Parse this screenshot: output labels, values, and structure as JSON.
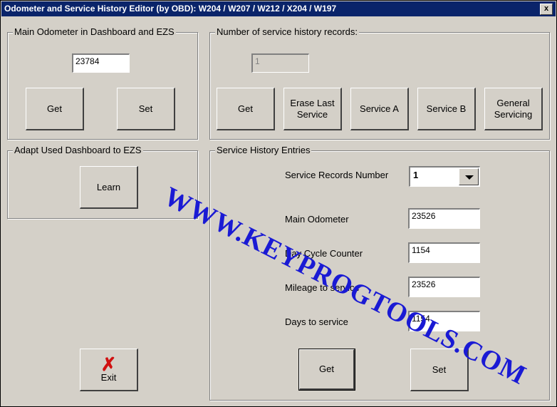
{
  "window": {
    "title": "Odometer and Service History Editor (by OBD): W204 / W207 / W212 / X204 / W197",
    "close_label": "x"
  },
  "odometer_group": {
    "label": "Main Odometer in Dashboard and EZS",
    "value": "23784",
    "get_label": "Get",
    "set_label": "Set"
  },
  "adapt_group": {
    "label": "Adapt Used Dashboard to EZS",
    "learn_label": "Learn"
  },
  "records_group": {
    "label": "Number of service history records:",
    "count": "1",
    "buttons": [
      "Get",
      "Erase Last Service",
      "Service A",
      "Service B",
      "General Servicing"
    ]
  },
  "entries_group": {
    "label": "Service History Entries",
    "records_number_label": "Service Records Number",
    "records_number_value": "1",
    "main_odometer_label": "Main Odometer",
    "main_odometer_value": "23526",
    "day_cycle_label": "Day Cycle Counter",
    "day_cycle_value": "1154",
    "mileage_label": "Mileage to service",
    "mileage_value": "23526",
    "days_label": "Days to service",
    "days_value": "1154",
    "get_label": "Get",
    "set_label": "Set"
  },
  "exit": {
    "label": "Exit",
    "icon": "red-x-icon"
  },
  "watermark": "WWW.KEYPROGTOOLS.COM"
}
